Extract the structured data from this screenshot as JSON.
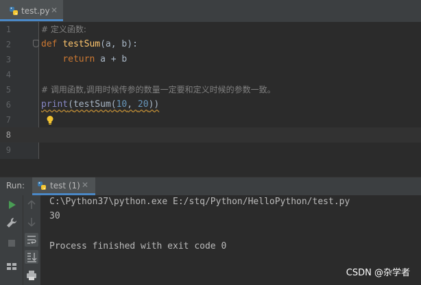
{
  "editor_tab": {
    "label": "test.py",
    "close": "✕"
  },
  "editor": {
    "line_numbers": [
      "1",
      "2",
      "3",
      "4",
      "5",
      "6",
      "7",
      "8",
      "9"
    ],
    "line1": "# 定义函数:",
    "line2": {
      "def": "def",
      "name": "testSum",
      "params": "(a, b):"
    },
    "line3": {
      "indent": "    ",
      "ret": "return",
      "expr": " a + b"
    },
    "line5": "# 调用函数,调用时候传参的数量一定要和定义时候的参数一致。",
    "line6": {
      "print": "print",
      "open": "(",
      "call": "testSum",
      "open2": "(",
      "n1": "10",
      "sep": ", ",
      "n2": "20",
      "close": "))"
    }
  },
  "run": {
    "label": "Run:",
    "tab_label": "test (1)",
    "tab_close": "✕",
    "console": {
      "command": "C:\\Python37\\python.exe E:/stq/Python/HelloPython/test.py",
      "output": "30",
      "finished": "Process finished with exit code 0"
    }
  },
  "watermark": "CSDN @杂学者",
  "colors": {
    "background": "#2b2b2b",
    "keyword": "#cc7832",
    "function": "#ffc66d",
    "number": "#6897bb",
    "comment": "#808080",
    "accent": "#4a88c7",
    "run_green": "#499c54"
  },
  "icons": [
    "python-file-icon",
    "fold-icon",
    "lightbulb-icon",
    "run-icon",
    "wrench-icon",
    "stop-icon",
    "layout-icon",
    "scroll-up-icon",
    "scroll-down-icon",
    "soft-wrap-icon",
    "scroll-to-end-icon",
    "print-icon"
  ]
}
